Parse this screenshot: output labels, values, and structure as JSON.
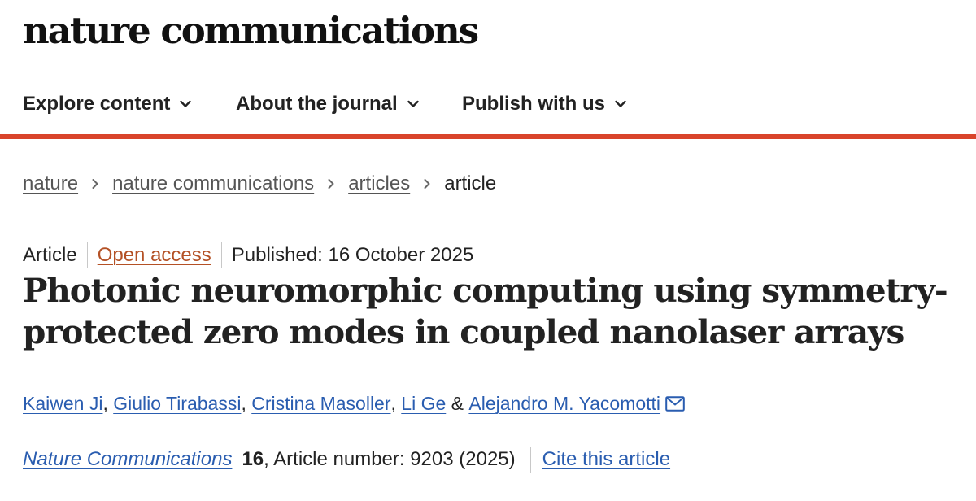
{
  "site": {
    "logo_text": "nature communications"
  },
  "nav": {
    "items": [
      {
        "label": "Explore content",
        "icon": "chevron-down-icon"
      },
      {
        "label": "About the journal",
        "icon": "chevron-down-icon"
      },
      {
        "label": "Publish with us",
        "icon": "chevron-down-icon"
      }
    ],
    "accent_color": "#d9442b"
  },
  "breadcrumb": {
    "items": [
      "nature",
      "nature communications",
      "articles"
    ],
    "current": "article",
    "separator_icon": "chevron-right-icon"
  },
  "article": {
    "type": "Article",
    "access": "Open access",
    "published": "Published: 16 October 2025",
    "title_lines": [
      "Photonic neuromorphic computing using symmetry-",
      "protected zero modes in coupled nanolaser arrays"
    ],
    "authors": [
      "Kaiwen Ji",
      "Giulio Tirabassi",
      "Cristina Masoller",
      "Li Ge",
      "Alejandro M. Yacomotti"
    ],
    "author_separator": ",",
    "author_last_separator": "&",
    "corresponding_icon": "envelope-icon"
  },
  "citation": {
    "journal": "Nature Communications",
    "volume": "16",
    "article_number": ", Article number: 9203 (2025)",
    "cite_label": "Cite this article"
  },
  "colors": {
    "link": "#2a5db0",
    "open_access": "#b45125",
    "text": "#222222"
  }
}
